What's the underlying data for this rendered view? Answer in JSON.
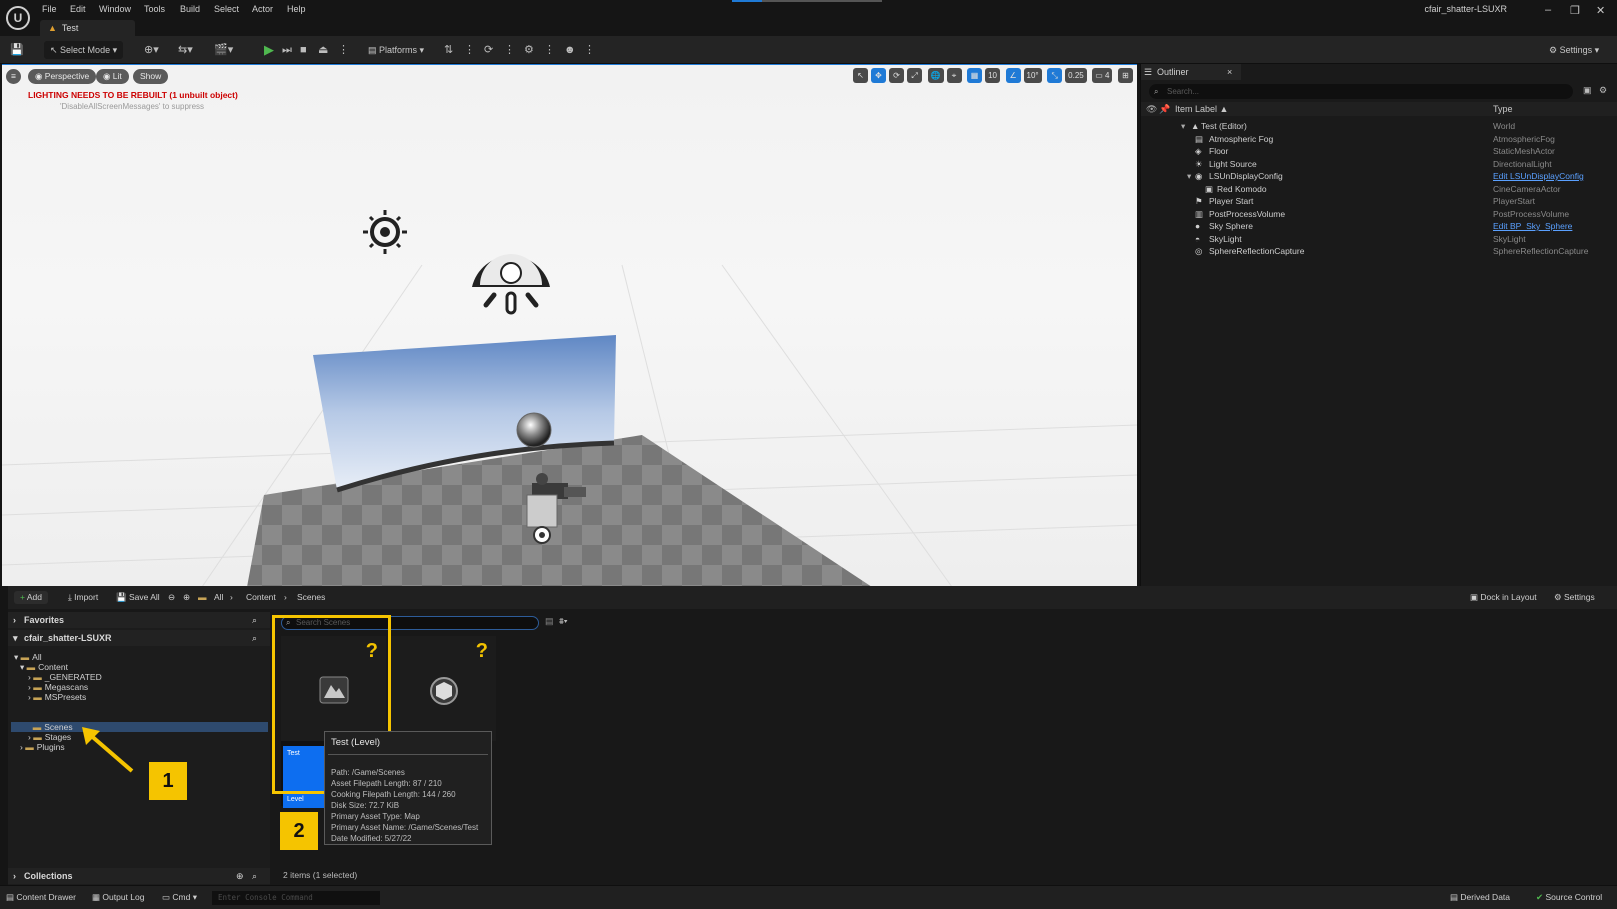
{
  "app": {
    "menu": [
      "File",
      "Edit",
      "Window",
      "Tools",
      "Build",
      "Select",
      "Actor",
      "Help"
    ],
    "level_tab": "Test",
    "project_name": "cfair_shatter-LSUXR",
    "window_controls": [
      "–",
      "❐",
      "✕"
    ]
  },
  "toolbar": {
    "select_mode": "Select Mode",
    "platforms": "Platforms",
    "settings": "Settings"
  },
  "viewport": {
    "perspective": "Perspective",
    "lit": "Lit",
    "show": "Show",
    "warning": "LIGHTING NEEDS TO BE REBUILT (1 unbuilt object)",
    "suppress_hint": "'DisableAllScreenMessages' to suppress",
    "grid_snap": "10",
    "rotation_snap": "10°",
    "scale_snap": "0.25",
    "camera_speed": "4"
  },
  "outliner": {
    "tab": "Outliner",
    "search_placeholder": "Search...",
    "col_label": "Item Label ▲",
    "col_type": "Type",
    "rows": [
      {
        "label": "Test (Editor)",
        "type": "World"
      },
      {
        "label": "Atmospheric Fog",
        "type": "AtmosphericFog"
      },
      {
        "label": "Floor",
        "type": "StaticMeshActor"
      },
      {
        "label": "Light Source",
        "type": "DirectionalLight"
      },
      {
        "label": "LSUnDisplayConfig",
        "type": "Edit LSUnDisplayConfig"
      },
      {
        "label": "Red Komodo",
        "type": "CineCameraActor"
      },
      {
        "label": "Player Start",
        "type": "PlayerStart"
      },
      {
        "label": "PostProcessVolume",
        "type": "PostProcessVolume"
      },
      {
        "label": "Sky Sphere",
        "type": "Edit BP_Sky_Sphere"
      },
      {
        "label": "SkyLight",
        "type": "SkyLight"
      },
      {
        "label": "SphereReflectionCapture",
        "type": "SphereReflectionCapture"
      }
    ]
  },
  "content_browser": {
    "add": "Add",
    "import": "Import",
    "save_all": "Save All",
    "breadcrumb": [
      "All",
      "Content",
      "Scenes"
    ],
    "dock_in_layout": "Dock in Layout",
    "settings": "Settings",
    "favorites": "Favorites",
    "project": "cfair_shatter-LSUXR",
    "collections": "Collections",
    "tree": [
      "All",
      "Content",
      "_GENERATED",
      "Megascans",
      "MSPresets",
      "Scenes",
      "Stages",
      "Plugins"
    ],
    "search_placeholder": "Search Scenes",
    "status": "2 items (1 selected)",
    "tile1_name": "Test",
    "tile1_class": "Level",
    "badge_1": "1",
    "badge_2": "2",
    "tooltip": {
      "title": "Test (Level)",
      "path": "Path: /Game/Scenes",
      "asset_filepath_length": "Asset Filepath Length: 87 / 210",
      "cooking_filepath_length": "Cooking Filepath Length: 144 / 260",
      "disk_size": "Disk Size: 72.7 KiB",
      "primary_asset_type": "Primary Asset Type: Map",
      "primary_asset_name": "Primary Asset Name: /Game/Scenes/Test",
      "date_modified": "Date Modified: 5/27/22"
    }
  },
  "statusbar": {
    "content_drawer": "Content Drawer",
    "output_log": "Output Log",
    "cmd": "Cmd",
    "console_placeholder": "Enter Console Command",
    "derived_data": "Derived Data",
    "source_control": "Source Control"
  },
  "colors": {
    "accent": "#1f7ad6",
    "highlight": "#f5c400",
    "warning": "#cc0000"
  }
}
